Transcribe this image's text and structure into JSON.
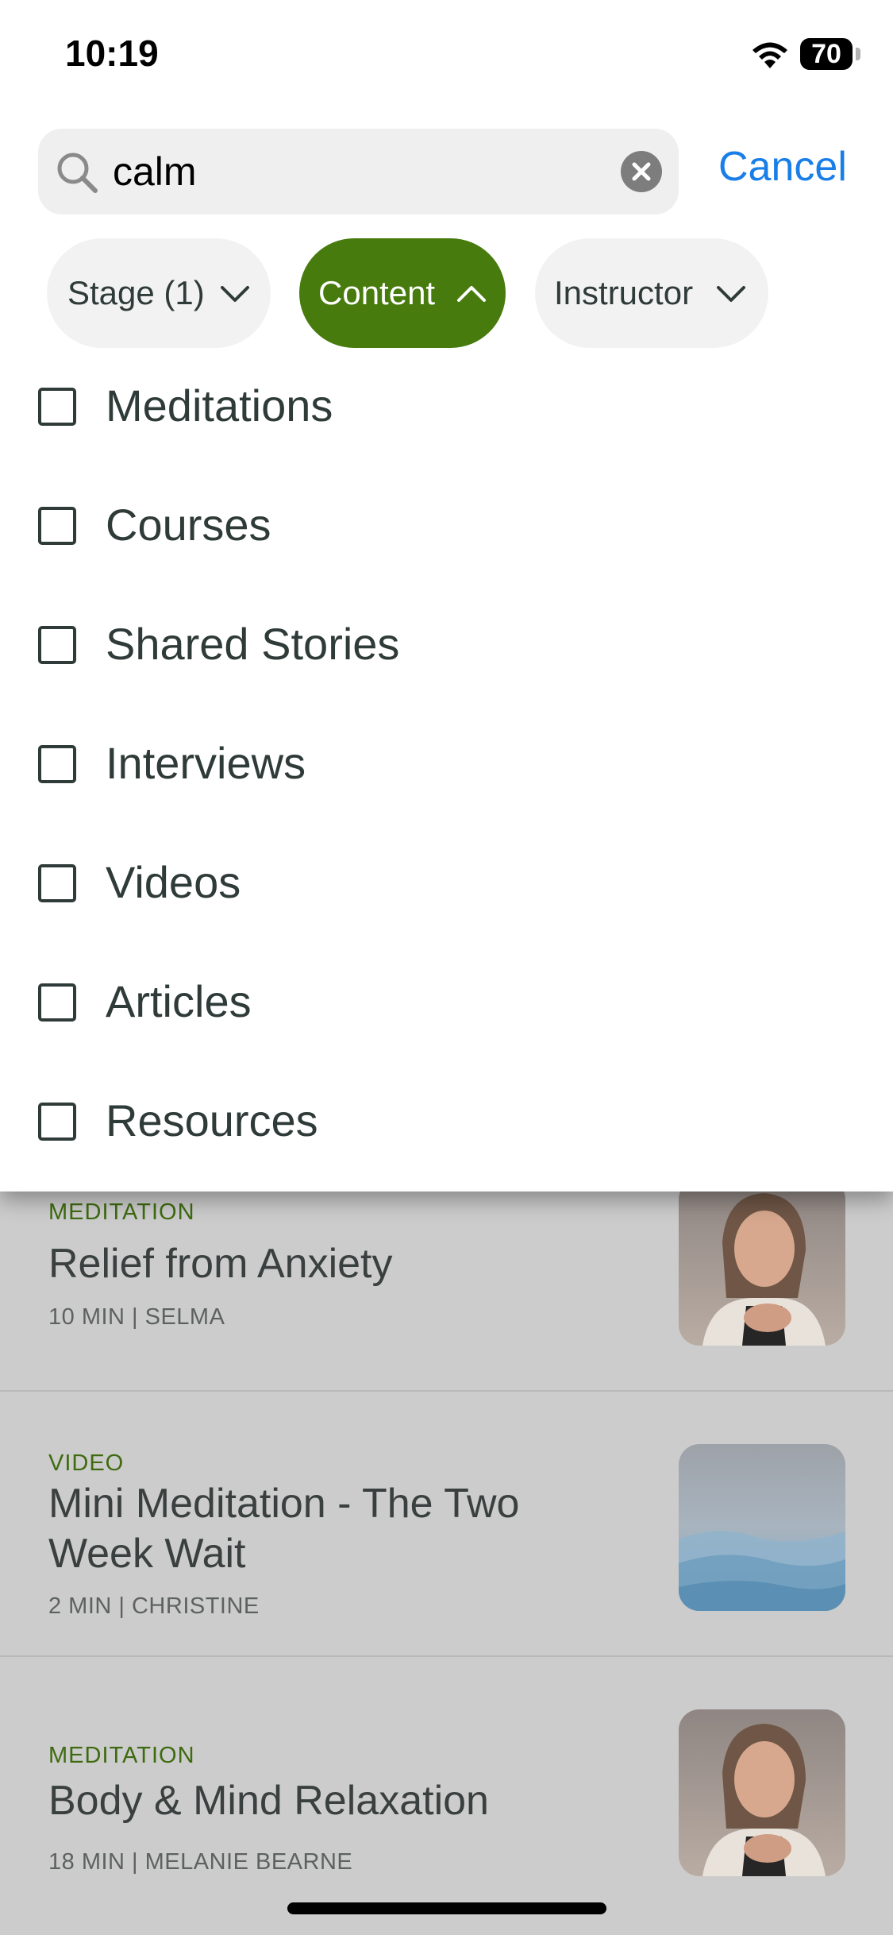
{
  "status_bar": {
    "time": "10:19",
    "battery": "70"
  },
  "search": {
    "value": "calm",
    "cancel_label": "Cancel"
  },
  "filters": [
    {
      "label": "Stage (1)",
      "expanded": false
    },
    {
      "label": "Content",
      "expanded": true
    },
    {
      "label": "Instructor",
      "expanded": false
    }
  ],
  "content_options": [
    {
      "label": "Meditations",
      "checked": false
    },
    {
      "label": "Courses",
      "checked": false
    },
    {
      "label": "Shared Stories",
      "checked": false
    },
    {
      "label": "Interviews",
      "checked": false
    },
    {
      "label": "Videos",
      "checked": false
    },
    {
      "label": "Articles",
      "checked": false
    },
    {
      "label": "Resources",
      "checked": false
    }
  ],
  "results": [
    {
      "type": "MEDITATION",
      "title": "Relief from Anxiety",
      "meta": "10 MIN | SELMA",
      "thumbnail": "woman-meditating-photo"
    },
    {
      "type": "VIDEO",
      "title": "Mini Meditation - The Two Week Wait",
      "meta": "2 MIN | CHRISTINE",
      "thumbnail": "misty-mountains-photo"
    },
    {
      "type": "MEDITATION",
      "title": "Body & Mind Relaxation",
      "meta": "18 MIN | MELANIE BEARNE",
      "thumbnail": "woman-meditating-photo"
    }
  ],
  "colors": {
    "accent_green": "#477b0d",
    "link_blue": "#1a7ee8",
    "type_green": "#3e6b10"
  }
}
